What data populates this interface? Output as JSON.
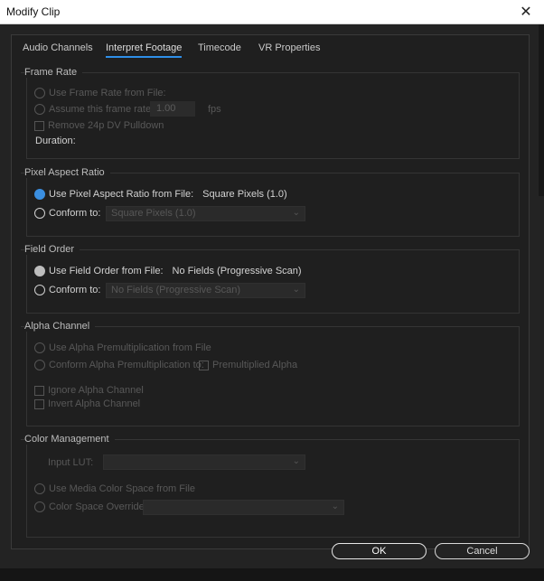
{
  "window": {
    "title": "Modify Clip"
  },
  "tabs": [
    {
      "label": "Audio Channels",
      "active": false
    },
    {
      "label": "Interpret Footage",
      "active": true
    },
    {
      "label": "Timecode",
      "active": false
    },
    {
      "label": "VR Properties",
      "active": false
    }
  ],
  "frame_rate": {
    "title": "Frame Rate",
    "use_from_file": "Use Frame Rate from File:",
    "assume": "Assume this frame rate:",
    "rate_value": "1.00",
    "rate_unit": "fps",
    "remove_pulldown": "Remove 24p DV Pulldown",
    "duration": "Duration:"
  },
  "pixel_aspect": {
    "title": "Pixel Aspect Ratio",
    "use_from_file": "Use Pixel Aspect Ratio from File:",
    "file_value": "Square Pixels (1.0)",
    "conform_to": "Conform to:",
    "conform_value": "Square Pixels (1.0)"
  },
  "field_order": {
    "title": "Field Order",
    "use_from_file": "Use Field Order from File:",
    "file_value": "No Fields (Progressive Scan)",
    "conform_to": "Conform to:",
    "conform_value": "No Fields (Progressive Scan)"
  },
  "alpha": {
    "title": "Alpha Channel",
    "use_premult": "Use Alpha Premultiplication from File",
    "conform_premult": "Conform Alpha Premultiplication to:",
    "premultiplied": "Premultiplied Alpha",
    "ignore": "Ignore Alpha Channel",
    "invert": "Invert Alpha Channel"
  },
  "color_mgmt": {
    "title": "Color Management",
    "input_lut": "Input LUT:",
    "use_media_space": "Use Media Color Space from File",
    "override": "Color Space Override:"
  },
  "buttons": {
    "ok": "OK",
    "cancel": "Cancel"
  },
  "colors": {
    "accent": "#2e8ee8",
    "selected_radio": "#3b8fe0",
    "background": "#1f1f1f"
  }
}
